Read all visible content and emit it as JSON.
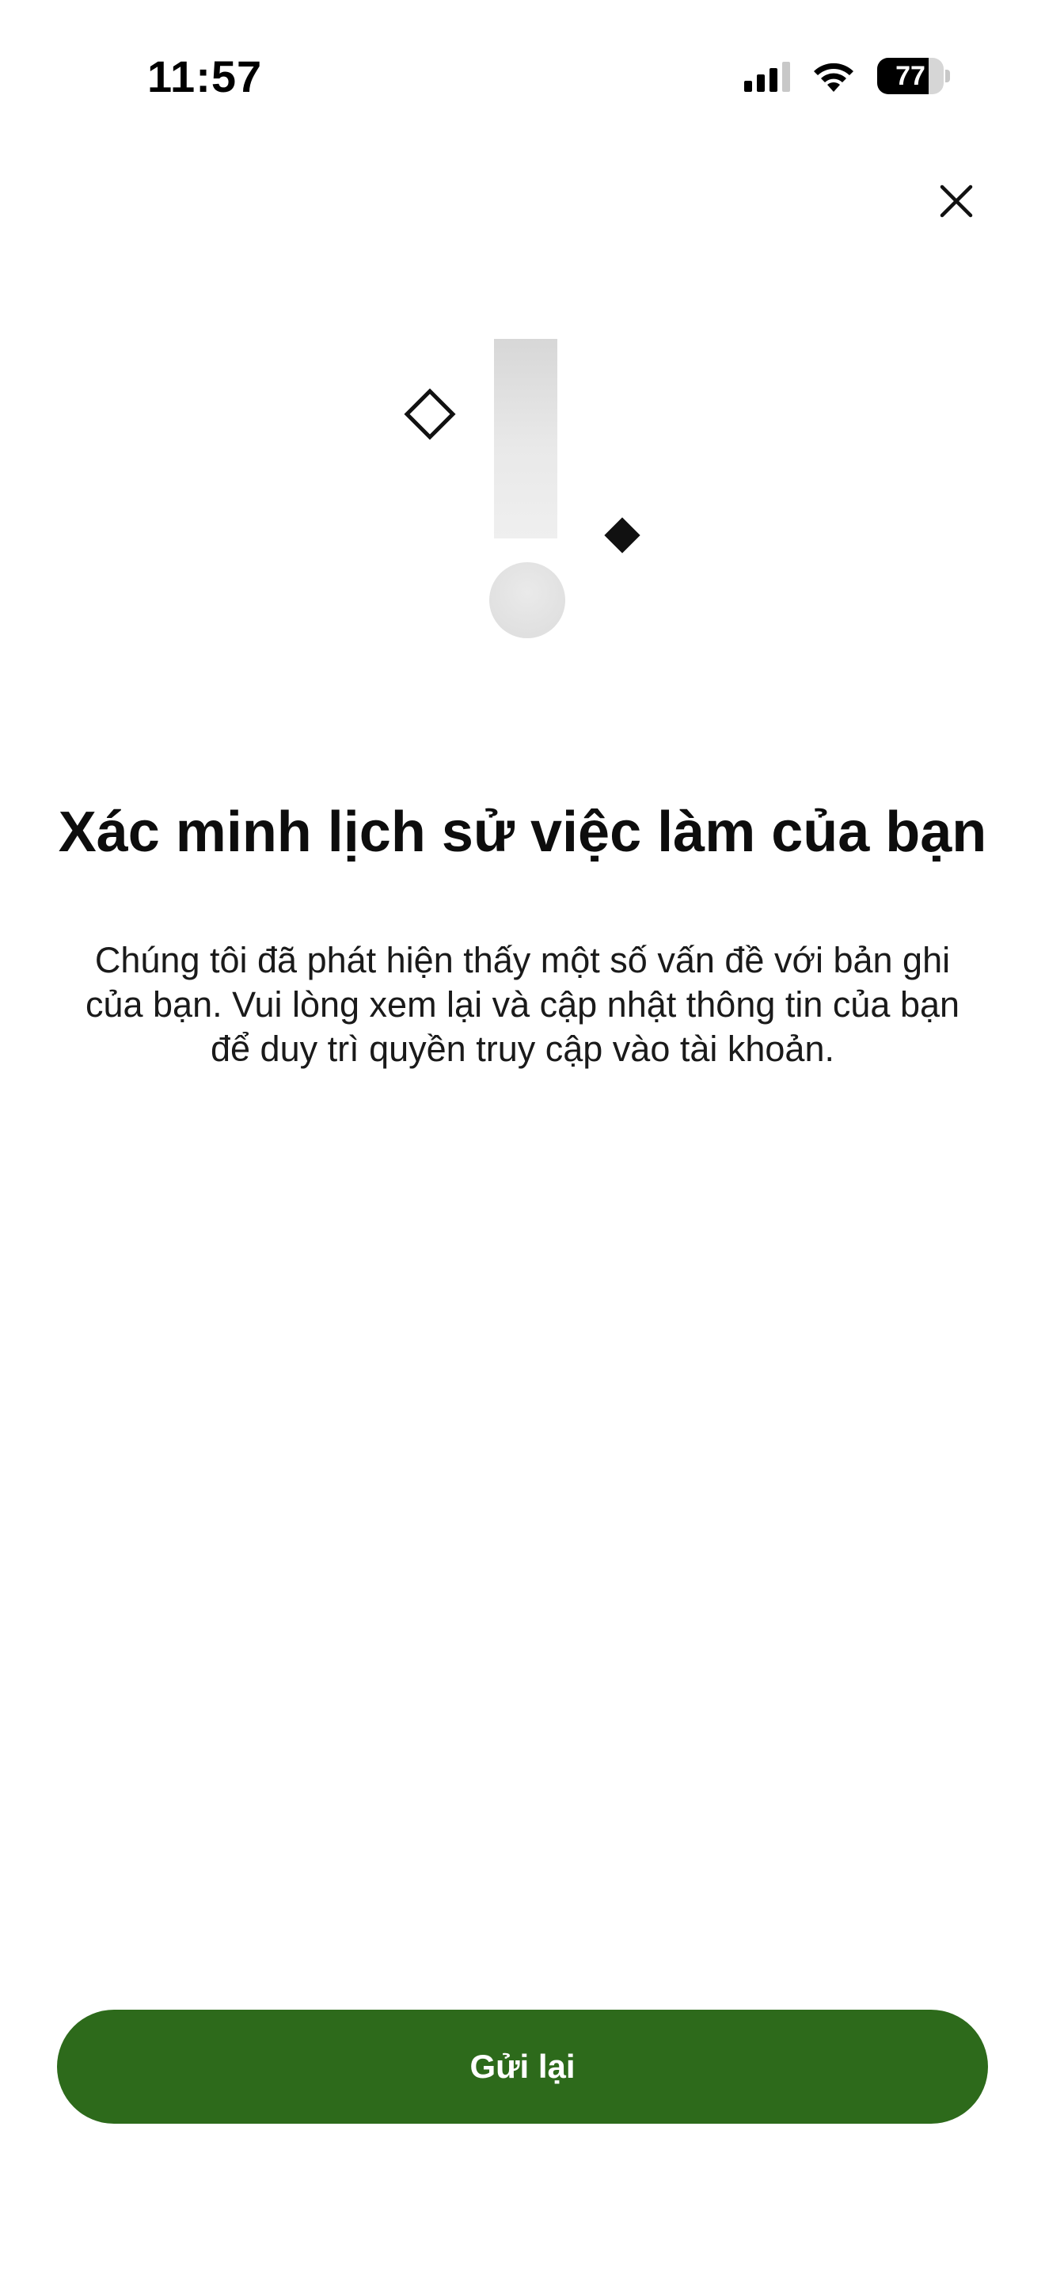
{
  "status_bar": {
    "time": "11:57",
    "battery_level": "77",
    "battery_fraction": 0.77
  },
  "icons": {
    "close": "close-icon",
    "signal": "cellular-signal-icon",
    "wifi": "wifi-icon",
    "battery": "battery-icon",
    "illustration": "exclamation-illustration"
  },
  "colors": {
    "primary_button": "#2d6a1b",
    "button_text": "#ffffff",
    "title_text": "#0d0d0d"
  },
  "content": {
    "title": "Xác minh lịch sử việc làm của bạn",
    "description": "Chúng tôi đã phát hiện thấy một số vấn đề với bản ghi của bạn. Vui lòng xem lại và cập nhật thông tin của bạn để duy trì quyền truy cập vào tài khoản."
  },
  "actions": {
    "resend_label": "Gửi lại"
  }
}
